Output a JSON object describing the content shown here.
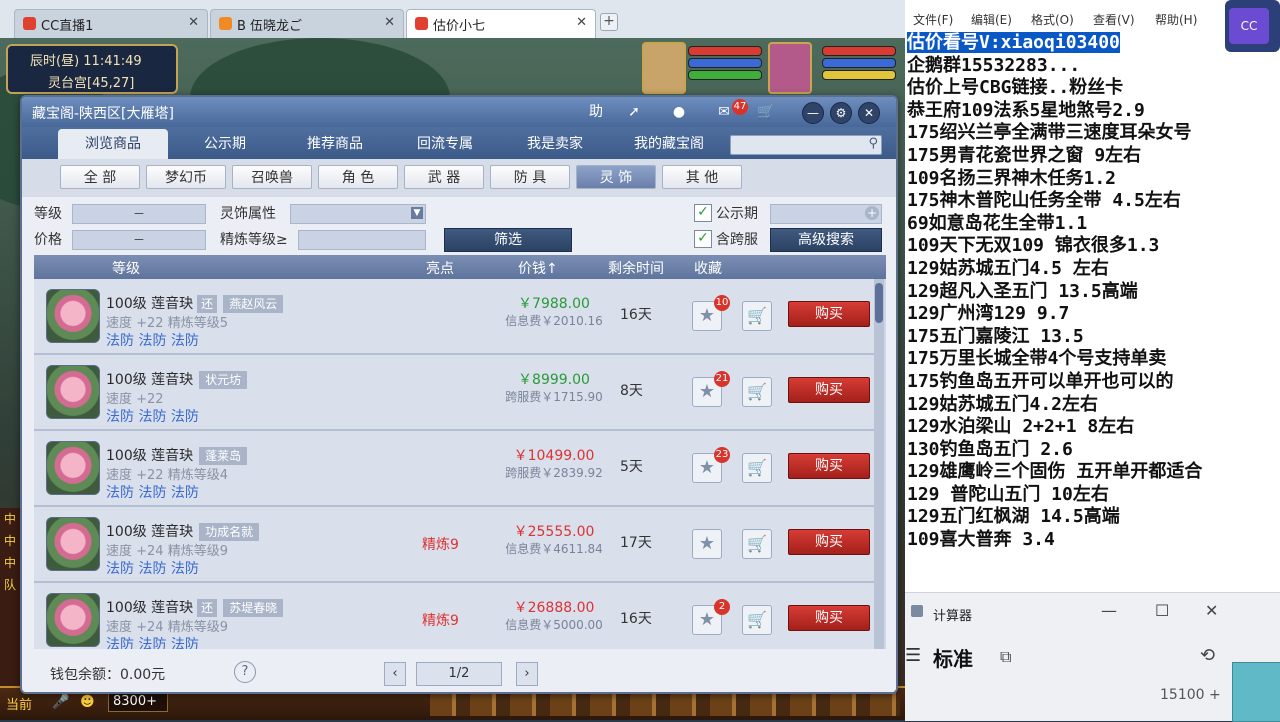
{
  "browser": {
    "tabs": [
      {
        "label": "CC直播1",
        "active": false
      },
      {
        "label": "B 伍晓龙ご",
        "active": false
      },
      {
        "label": "估价小七",
        "active": true
      }
    ],
    "new_tab": "+"
  },
  "hud": {
    "time": "辰时(昼)  11:41:49",
    "location": "灵台宫[45,27]"
  },
  "window": {
    "title": "藏宝阁-陕西区[大雁塔]",
    "help_label": "助",
    "msg_count": "47",
    "tabs": [
      "浏览商品",
      "公示期",
      "推荐商品",
      "回流专属",
      "我是卖家",
      "我的藏宝阁"
    ],
    "active_tab": "浏览商品",
    "categories": [
      "全 部",
      "梦幻币",
      "召唤兽",
      "角 色",
      "武 器",
      "防 具",
      "灵 饰",
      "其 他"
    ],
    "active_category": "灵 饰",
    "filters": {
      "level_label": "等级",
      "level_value": "－",
      "price_label": "价格",
      "price_value": "－",
      "attr_label": "灵饰属性",
      "refine_label": "精炼等级≥",
      "public_label": "公示期",
      "cross_label": "含跨服",
      "filter_button": "筛选",
      "advanced_button": "高级搜索"
    },
    "columns": [
      "等级",
      "亮点",
      "价钱↑",
      "剩余时间",
      "收藏"
    ],
    "items": [
      {
        "level_name": "100级  莲音玦",
        "tag_small": "还",
        "tag": "燕赵风云",
        "stats": "速度 +22  精炼等级5",
        "attrs": "法防  法防  法防",
        "highlight": "",
        "price": "￥7988.00",
        "price_color": "#2a9a3a",
        "fee": "信息费￥2010.16",
        "days": "16天",
        "fav": "10",
        "buy": "购买"
      },
      {
        "level_name": "100级  莲音玦",
        "tag_small": "",
        "tag": "状元坊",
        "stats": "速度 +22",
        "attrs": "法防  法防  法防",
        "highlight": "",
        "price": "￥8999.00",
        "price_color": "#2a9a3a",
        "fee": "跨服费￥1715.90",
        "days": "8天",
        "fav": "21",
        "buy": "购买"
      },
      {
        "level_name": "100级  莲音玦",
        "tag_small": "",
        "tag": "蓬莱岛",
        "stats": "速度 +22  精炼等级4",
        "attrs": "法防  法防  法防",
        "highlight": "",
        "price": "￥10499.00",
        "price_color": "#d33",
        "fee": "跨服费￥2839.92",
        "days": "5天",
        "fav": "23",
        "buy": "购买"
      },
      {
        "level_name": "100级  莲音玦",
        "tag_small": "",
        "tag": "功成名就",
        "stats": "速度 +24  精炼等级9",
        "attrs": "法防  法防  法防",
        "highlight": "精炼9",
        "price": "￥25555.00",
        "price_color": "#d33",
        "fee": "信息费￥4611.84",
        "days": "17天",
        "fav": "",
        "buy": "购买"
      },
      {
        "level_name": "100级  莲音玦",
        "tag_small": "还",
        "tag": "苏堤春晓",
        "stats": "速度 +24  精炼等级9",
        "attrs": "法防  法防  法防",
        "highlight": "精炼9",
        "price": "￥26888.00",
        "price_color": "#d33",
        "fee": "信息费￥5000.00",
        "days": "16天",
        "fav": "2",
        "buy": "购买"
      }
    ],
    "wallet": "钱包余额：0.00元",
    "help_icon": "?",
    "page": "1/2"
  },
  "game_bottom": {
    "current": "当前",
    "count": "8300+"
  },
  "chat_edge": [
    "中",
    "中",
    "中",
    "队"
  ],
  "notepad": {
    "menu": [
      "文件(F)",
      "编辑(E)",
      "格式(O)",
      "查看(V)",
      "帮助(H)"
    ],
    "lines": [
      "估价看号V:xiaoqi03400",
      "企鹅群15532283...",
      "估价上号CBG链接..粉丝卡",
      "恭王府109法系5星地煞号2.9",
      "175绍兴兰亭全满带三速度耳朵女号",
      "175男青花瓷世界之窗  9左右",
      "109名扬三界神木任务1.2",
      "175神木普陀山任务全带 4.5左右",
      "69如意岛花生全带1.1",
      "109天下无双109  锦衣很多1.3",
      "129姑苏城五门4.5 左右",
      "129超凡入圣五门  13.5高端",
      "129广州湾129 9.7",
      "175五门嘉陵江 13.5",
      "175万里长城全带4个号支持单卖",
      "175钓鱼岛五开可以单开也可以的",
      "129姑苏城五门4.2左右",
      "129水泊梁山 2+2+1 8左右",
      "130钓鱼岛五门  2.6",
      "129雄鹰岭三个固伤 五开单开都适合",
      "129 普陀山五门  10左右",
      "129五门红枫湖 14.5高端",
      "109喜大普奔  3.4"
    ]
  },
  "calculator": {
    "title": "计算器",
    "mode": "标准",
    "display": "15100 +"
  },
  "colors": {
    "window_title": "#48689a",
    "buy_button": "#c22a24",
    "selection": "#0a58c5"
  }
}
